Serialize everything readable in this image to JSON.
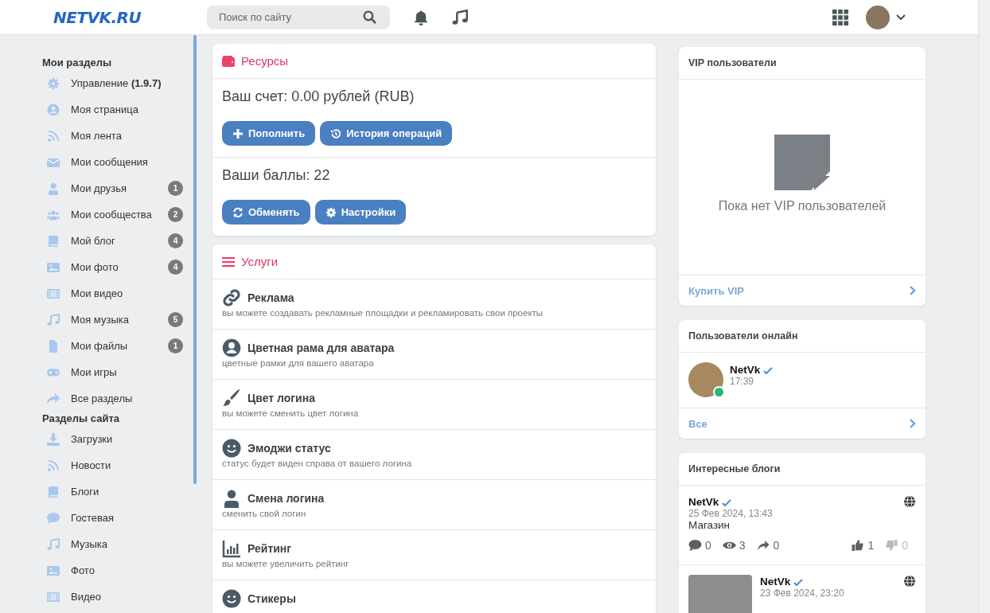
{
  "header": {
    "logo": "NETVK.RU",
    "search": {
      "placeholder": "Поиск по сайту"
    }
  },
  "sidebar": {
    "sections": [
      {
        "title": "Мои разделы",
        "items": [
          {
            "label": "Управление **(1.9.7)**"
          },
          {
            "label": "Моя страница"
          },
          {
            "label": "Моя лента"
          },
          {
            "label": "Мои сообщения"
          },
          {
            "label": "Мои друзья",
            "badge": "1"
          },
          {
            "label": "Мои сообщества",
            "badge": "2"
          },
          {
            "label": "Мой блог",
            "badge": "4"
          },
          {
            "label": "Мои фото",
            "badge": "4"
          },
          {
            "label": "Мои видео"
          },
          {
            "label": "Моя музыка",
            "badge": "5"
          },
          {
            "label": "Мои файлы",
            "badge": "1"
          },
          {
            "label": "Мои игры"
          },
          {
            "label": "Все разделы"
          }
        ]
      },
      {
        "title": "Разделы сайта",
        "items": [
          {
            "label": "Загрузки"
          },
          {
            "label": "Новости"
          },
          {
            "label": "Блоги"
          },
          {
            "label": "Гостевая"
          },
          {
            "label": "Музыка"
          },
          {
            "label": "Фото"
          },
          {
            "label": "Видео"
          }
        ]
      }
    ]
  },
  "resources": {
    "title": "Ресурсы",
    "balance": "Ваш счет: 0.00 рублей (RUB)",
    "balance_buttons": [
      "Пополнить",
      "История операций"
    ],
    "points": "Ваши баллы: 22",
    "points_buttons": [
      "Обменять",
      "Настройки"
    ]
  },
  "services": {
    "title": "Услуги",
    "items": [
      {
        "title": "Реклама",
        "description": "вы можете создавать рекламные площадки и рекламировать свои проекты"
      },
      {
        "title": "Цветная рама для аватара",
        "description": "цветные рамки для вашего аватара"
      },
      {
        "title": "Цвет логина",
        "description": "вы можете сменить цвет логина"
      },
      {
        "title": "Эмоджи статус",
        "description": "статус будет виден справа от вашего логина"
      },
      {
        "title": "Смена логина",
        "description": "сменить свой логин"
      },
      {
        "title": "Рейтинг",
        "description": "вы можете увеличить рейтинг"
      },
      {
        "title": "Стикеры"
      }
    ]
  },
  "vip": {
    "title": "VIP пользователи",
    "empty": "Пока нет VIP пользователей",
    "footer_link": "Купить VIP"
  },
  "online": {
    "title": "Пользователи онлайн",
    "users": [
      {
        "name": "NetVk",
        "time": "17:39",
        "verified": true
      }
    ],
    "footer_link": "Все"
  },
  "blogs": {
    "title": "Интересные блоги",
    "posts": [
      {
        "author": "NetVk",
        "verified": true,
        "date": "25 Фев 2024, 13:43",
        "title": "Магазин",
        "comments": "0",
        "views": "3",
        "shares": "0",
        "likes": "1",
        "dislikes": "0"
      },
      {
        "author": "NetVk",
        "verified": true,
        "date": "23 Фев 2024, 23:20",
        "thumbnail": true
      }
    ]
  }
}
